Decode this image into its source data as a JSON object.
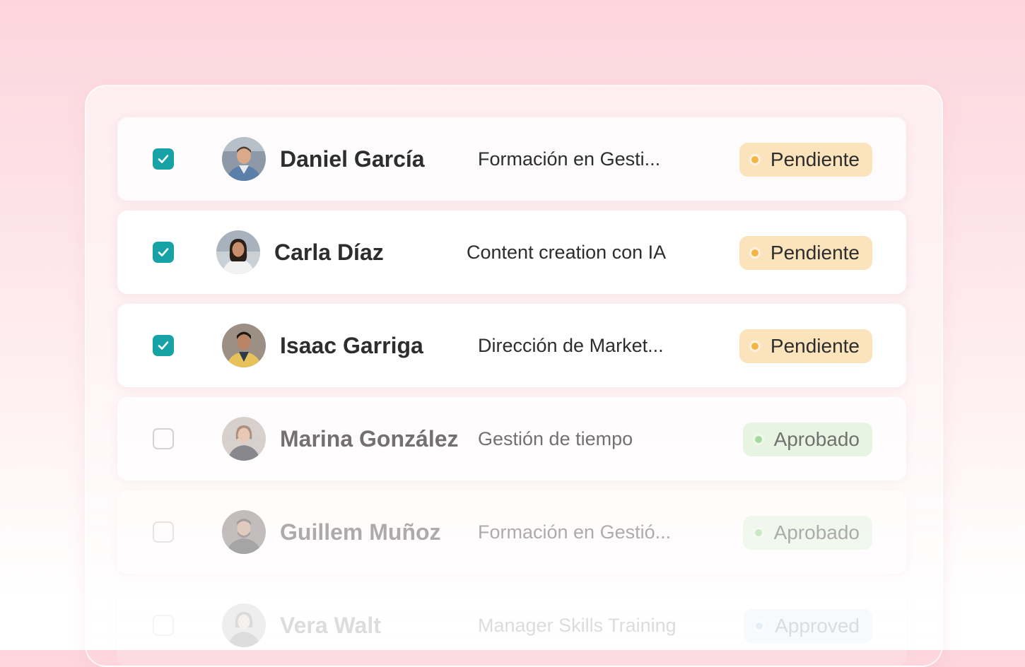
{
  "rows": [
    {
      "name": "Daniel García",
      "course": "Formación en Gesti...",
      "status": "Pendiente",
      "checked": true
    },
    {
      "name": "Carla Díaz",
      "course": "Content creation con IA",
      "status": "Pendiente",
      "checked": true
    },
    {
      "name": "Isaac Garriga",
      "course": "Dirección de Market...",
      "status": "Pendiente",
      "checked": true
    },
    {
      "name": "Marina González",
      "course": "Gestión de tiempo",
      "status": "Aprobado",
      "checked": false
    },
    {
      "name": "Guillem Muñoz",
      "course": "Formación en Gestió...",
      "status": "Aprobado",
      "checked": false
    },
    {
      "name": "Vera Walt",
      "course": "Manager Skills Training",
      "status": "Approved",
      "checked": false
    }
  ],
  "colors": {
    "checkbox_on": "#17a2a6",
    "pending_badge": "#fbe3bc",
    "pending_dot": "#f5b544",
    "approved_badge": "#dff3da",
    "approved_dot": "#7fd07a"
  }
}
